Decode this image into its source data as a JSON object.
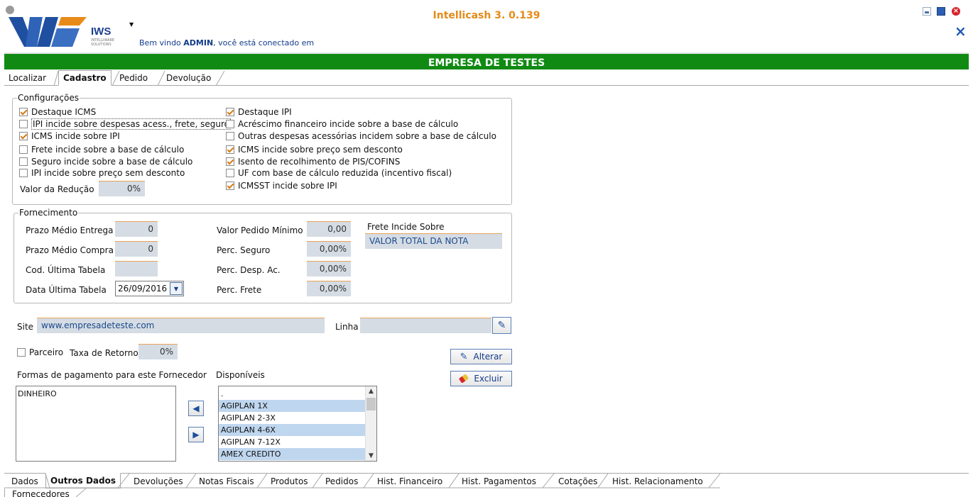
{
  "app": {
    "title": "Intellicash 3. 0.139",
    "logo_text": "IWS",
    "logo_sub": "INTELLIWARE SOLUTIONS",
    "welcome_prefix": "Bem vindo ",
    "welcome_user": "ADMIN",
    "welcome_suffix": ", você está conectado em",
    "company": "EMPRESA DE TESTES"
  },
  "top_tabs": [
    "Localizar",
    "Cadastro",
    "Pedido",
    "Devolução"
  ],
  "configuracoes": {
    "legend": "Configurações",
    "left": [
      {
        "label": "Destaque ICMS",
        "checked": true
      },
      {
        "label": "IPI incide sobre despesas acess., frete, seguro",
        "checked": false
      },
      {
        "label": "ICMS incide sobre IPI",
        "checked": true
      },
      {
        "label": "Frete incide sobre a base de cálculo",
        "checked": false
      },
      {
        "label": "Seguro incide sobre a base de cálculo",
        "checked": false
      },
      {
        "label": "IPI incide sobre preço sem desconto",
        "checked": false
      }
    ],
    "right": [
      {
        "label": "Destaque IPI",
        "checked": true
      },
      {
        "label": "Acréscimo financeiro incide sobre a base de cálculo",
        "checked": false
      },
      {
        "label": "Outras despesas acessórias incidem sobre a base de cálculo",
        "checked": false
      },
      {
        "label": "ICMS incide sobre preço sem desconto",
        "checked": true
      },
      {
        "label": "Isento de recolhimento de PIS/COFINS",
        "checked": true
      },
      {
        "label": "UF com base de cálculo reduzida (incentivo fiscal)",
        "checked": false
      },
      {
        "label": "ICMSST incide sobre IPI",
        "checked": true
      }
    ],
    "valor_reducao_label": "Valor da Redução",
    "valor_reducao": "0%"
  },
  "fornecimento": {
    "legend": "Fornecimento",
    "prazo_entrega_label": "Prazo Médio Entrega",
    "prazo_entrega": "0",
    "prazo_compra_label": "Prazo Médio Compra",
    "prazo_compra": "0",
    "cod_tabela_label": "Cod. Última Tabela",
    "cod_tabela": "",
    "data_tabela_label": "Data Última Tabela",
    "data_tabela": "26/09/2016",
    "valor_pedido_label": "Valor Pedido Mínimo",
    "valor_pedido": "0,00",
    "perc_seguro_label": "Perc. Seguro",
    "perc_seguro": "0,00%",
    "perc_desp_label": "Perc. Desp. Ac.",
    "perc_desp": "0,00%",
    "perc_frete_label": "Perc. Frete",
    "perc_frete": "0,00%",
    "frete_incide_label": "Frete Incide Sobre",
    "frete_incide": "VALOR TOTAL DA NOTA"
  },
  "site": {
    "label": "Site",
    "value": "www.empresadeteste.com"
  },
  "linha": {
    "label": "Linha",
    "value": ""
  },
  "parceiro": {
    "label": "Parceiro",
    "checked": false
  },
  "taxa_retorno": {
    "label": "Taxa de Retorno",
    "value": "0%"
  },
  "buttons": {
    "alterar": "Alterar",
    "excluir": "Excluir"
  },
  "formas": {
    "label": "Formas de pagamento para este Fornecedor",
    "items": [
      "DINHEIRO"
    ]
  },
  "disponiveis": {
    "label": "Disponíveis",
    "items": [
      ".",
      "AGIPLAN 1X",
      "AGIPLAN 2-3X",
      "AGIPLAN 4-6X",
      "AGIPLAN 7-12X",
      "AMEX CREDITO"
    ]
  },
  "bottom_tabs": [
    "Dados",
    "Outros Dados",
    "Devoluções",
    "Notas Fiscais",
    "Produtos",
    "Pedidos",
    "Hist. Financeiro",
    "Hist. Pagamentos",
    "Cotações",
    "Hist. Relacionamento"
  ],
  "footer_tab": "Fornecedores"
}
